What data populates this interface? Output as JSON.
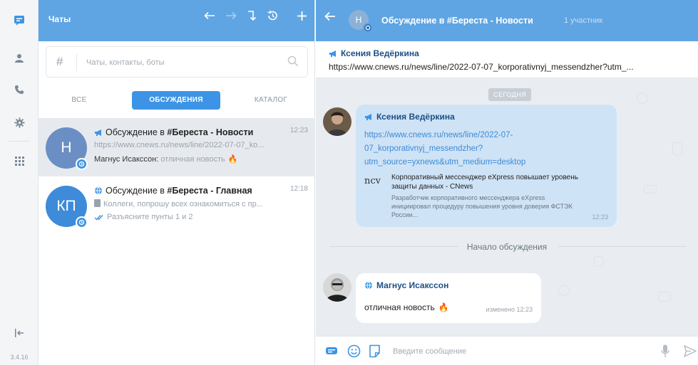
{
  "colors": {
    "accent": "#5fa5e3",
    "tab_active": "#3d94e6",
    "link": "#3d8ad6",
    "author": "#1d4f85",
    "selected_row": "#e6eaee"
  },
  "rail": {
    "items": [
      {
        "name": "chats",
        "icon": "chat-bubble-icon"
      },
      {
        "name": "contacts",
        "icon": "person-icon"
      },
      {
        "name": "calls",
        "icon": "phone-icon"
      },
      {
        "name": "settings",
        "icon": "gear-icon"
      },
      {
        "name": "apps",
        "icon": "grid-icon"
      }
    ],
    "collapse_icon": "collapse-left-icon",
    "version": "3.4.16"
  },
  "left": {
    "title": "Чаты",
    "search": {
      "hash": "#",
      "placeholder": "Чаты, контакты, боты"
    },
    "tabs": [
      {
        "label": "ВСЕ",
        "active": false
      },
      {
        "label": "ОБСУЖДЕНИЯ",
        "active": true
      },
      {
        "label": "КАТАЛОГ",
        "active": false
      }
    ],
    "chats": [
      {
        "avatar_text": "Н",
        "avatar_color": "#6b8fc4",
        "title_prefix": "Обсуждение в ",
        "title_bold": "#Береста - Новости",
        "time": "12:23",
        "line2": "https://www.cnews.ru/news/line/2022-07-07_ko...",
        "sender": "Магнус Исакссон:",
        "text": " отличная новость",
        "emoji": "🔥",
        "selected": true
      },
      {
        "avatar_text": "КП",
        "avatar_color": "#3d8bd9",
        "title_prefix": "Обсуждение в ",
        "title_bold": "#Береста - Главная",
        "time": "12:18",
        "line2": "Коллеги, попрошу всех ознакомиться с пр...",
        "text": "Разъясните пунты 1 и 2",
        "selected": false
      }
    ]
  },
  "right": {
    "header": {
      "avatar_text": "Н",
      "title": "Обсуждение в #Береста - Новости",
      "subtitle": "1 участник"
    },
    "pinned": {
      "author": "Ксения Ведёркина",
      "text": "https://www.cnews.ru/news/line/2022-07-07_korporativnyj_messendzher?utm_..."
    },
    "date_chip": "СЕГОДНЯ",
    "message1": {
      "author": "Ксения Ведёркина",
      "link_lines": [
        "https://www.cnews.ru/news/line/2022-07-",
        "07_korporativnyj_messendzher?",
        "utm_source=yxnews&utm_medium=desktop"
      ],
      "preview_logo": "ncv",
      "preview_title": "Корпоративный мессенджер eXpress повышает уровень защиты данных - CNews",
      "preview_desc": "Разработчик корпоративного мессенджера eXpress инициировал процедуру повышения уровня доверия ФСТЭК России...",
      "time": "12:23"
    },
    "start_label": "Начало обсуждения",
    "message2": {
      "author": "Магнус Исакссон",
      "text": "отличная новость",
      "emoji": "🔥",
      "time": "изменено 12:23"
    },
    "composer": {
      "placeholder": "Введите сообщение"
    }
  }
}
